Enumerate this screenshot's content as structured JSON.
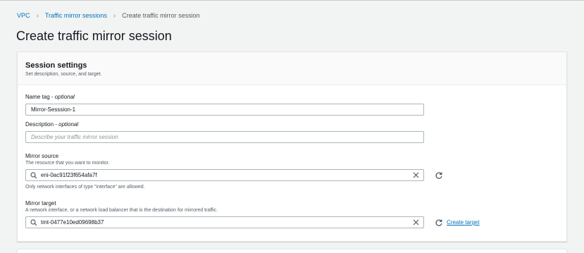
{
  "breadcrumb": {
    "items": [
      "VPC",
      "Traffic mirror sessions"
    ],
    "current": "Create traffic mirror session"
  },
  "page": {
    "title": "Create traffic mirror session"
  },
  "session_settings": {
    "title": "Session settings",
    "description": "Set description, source, and target.",
    "name_tag": {
      "label": "Name tag",
      "optional": "optional",
      "value": "Mirror-Sesssion-1"
    },
    "description_field": {
      "label": "Description",
      "optional": "optional",
      "placeholder": "Describe your traffic mirror session"
    },
    "mirror_source": {
      "label": "Mirror source",
      "hint": "The resource that you want to monitor.",
      "value": "eni-0ac91f23f654afa7f",
      "constraint": "Only network interfaces of type \"interface\" are allowed."
    },
    "mirror_target": {
      "label": "Mirror target",
      "hint": "A network interface, or a network load balancer that is the destination for mirrored traffic.",
      "value": "tmt-0477e10ed09698b37",
      "create_link": "Create target"
    }
  },
  "icons": {
    "search": "search-icon",
    "clear": "close-icon",
    "refresh": "refresh-icon"
  },
  "colors": {
    "link": "#0073bb",
    "background": "#f2f3f3"
  }
}
